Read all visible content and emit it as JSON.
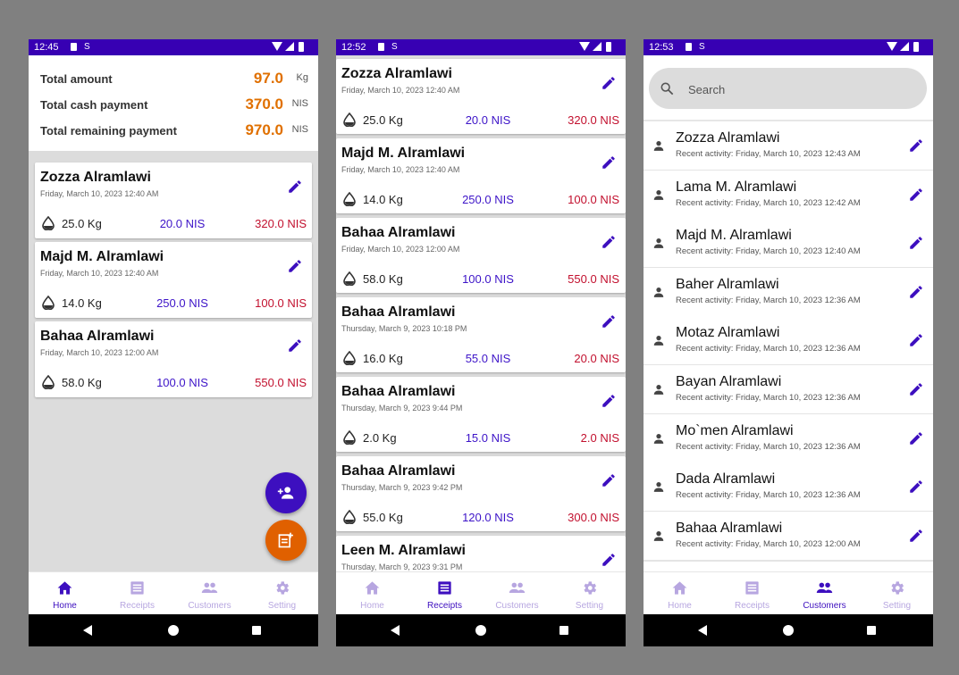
{
  "colors": {
    "status_bar": "#3700b3",
    "accent": "#3d0fbf",
    "summary_value": "#e07000",
    "cash": "#3d14c8",
    "remaining": "#c2102e",
    "fab_primary": "#3d0fbf",
    "fab_secondary": "#e06000",
    "nav_active": "#3d0fbf",
    "nav_inactive": "#b7a6e0"
  },
  "phones": [
    {
      "status_time": "12:45",
      "summary": {
        "rows": [
          {
            "label": "Total amount",
            "value": "97.0",
            "unit": "Kg"
          },
          {
            "label": "Total cash payment",
            "value": "370.0",
            "unit": "NIS"
          },
          {
            "label": "Total remaining payment",
            "value": "970.0",
            "unit": "NIS"
          }
        ]
      },
      "receipts": [
        {
          "name": "Zozza Alramlawi",
          "date": "Friday, March 10, 2023 12:40 AM",
          "kg": "25.0 Kg",
          "cash": "20.0 NIS",
          "remaining": "320.0 NIS"
        },
        {
          "name": "Majd M. Alramlawi",
          "date": "Friday, March 10, 2023 12:40 AM",
          "kg": "14.0 Kg",
          "cash": "250.0 NIS",
          "remaining": "100.0 NIS"
        },
        {
          "name": "Bahaa Alramlawi",
          "date": "Friday, March 10, 2023 12:00 AM",
          "kg": "58.0 Kg",
          "cash": "100.0 NIS",
          "remaining": "550.0 NIS"
        }
      ],
      "fab_icons": [
        "person-add-icon",
        "new-receipt-icon"
      ],
      "active_tab": "Home"
    },
    {
      "status_time": "12:52",
      "receipts": [
        {
          "name": "Zozza Alramlawi",
          "date": "Friday, March 10, 2023 12:40 AM",
          "kg": "25.0 Kg",
          "cash": "20.0 NIS",
          "remaining": "320.0 NIS"
        },
        {
          "name": "Majd M. Alramlawi",
          "date": "Friday, March 10, 2023 12:40 AM",
          "kg": "14.0 Kg",
          "cash": "250.0 NIS",
          "remaining": "100.0 NIS"
        },
        {
          "name": "Bahaa Alramlawi",
          "date": "Friday, March 10, 2023 12:00 AM",
          "kg": "58.0 Kg",
          "cash": "100.0 NIS",
          "remaining": "550.0 NIS"
        },
        {
          "name": "Bahaa Alramlawi",
          "date": "Thursday, March 9, 2023 10:18 PM",
          "kg": "16.0 Kg",
          "cash": "55.0 NIS",
          "remaining": "20.0 NIS"
        },
        {
          "name": "Bahaa Alramlawi",
          "date": "Thursday, March 9, 2023 9:44 PM",
          "kg": "2.0 Kg",
          "cash": "15.0 NIS",
          "remaining": "2.0 NIS"
        },
        {
          "name": "Bahaa Alramlawi",
          "date": "Thursday, March 9, 2023 9:42 PM",
          "kg": "55.0 Kg",
          "cash": "120.0 NIS",
          "remaining": "300.0 NIS"
        },
        {
          "name": "Leen M. Alramlawi",
          "date": "Thursday, March 9, 2023 9:31 PM",
          "kg": "",
          "cash": "",
          "remaining": ""
        }
      ],
      "active_tab": "Receipts"
    },
    {
      "status_time": "12:53",
      "search": {
        "placeholder": "Search"
      },
      "customers": [
        {
          "name": "Zozza Alramlawi",
          "activity": "Recent activity: Friday, March 10, 2023 12:43 AM"
        },
        {
          "name": "Lama M. Alramlawi",
          "activity": "Recent activity: Friday, March 10, 2023 12:42 AM"
        },
        {
          "name": "Majd M. Alramlawi",
          "activity": "Recent activity: Friday, March 10, 2023 12:40 AM"
        },
        {
          "name": "Baher Alramlawi",
          "activity": "Recent activity: Friday, March 10, 2023 12:36 AM"
        },
        {
          "name": "Motaz Alramlawi",
          "activity": "Recent activity: Friday, March 10, 2023 12:36 AM"
        },
        {
          "name": "Bayan Alramlawi",
          "activity": "Recent activity: Friday, March 10, 2023 12:36 AM"
        },
        {
          "name": "Mo`men Alramlawi",
          "activity": "Recent activity: Friday, March 10, 2023 12:36 AM"
        },
        {
          "name": "Dada Alramlawi",
          "activity": "Recent activity: Friday, March 10, 2023 12:36 AM"
        },
        {
          "name": "Bahaa Alramlawi",
          "activity": "Recent activity: Friday, March 10, 2023 12:00 AM"
        }
      ],
      "active_tab": "Customers"
    }
  ],
  "nav_tabs": [
    {
      "label": "Home",
      "icon": "home-icon"
    },
    {
      "label": "Receipts",
      "icon": "receipt-icon"
    },
    {
      "label": "Customers",
      "icon": "people-icon"
    },
    {
      "label": "Setting",
      "icon": "gear-icon"
    }
  ]
}
